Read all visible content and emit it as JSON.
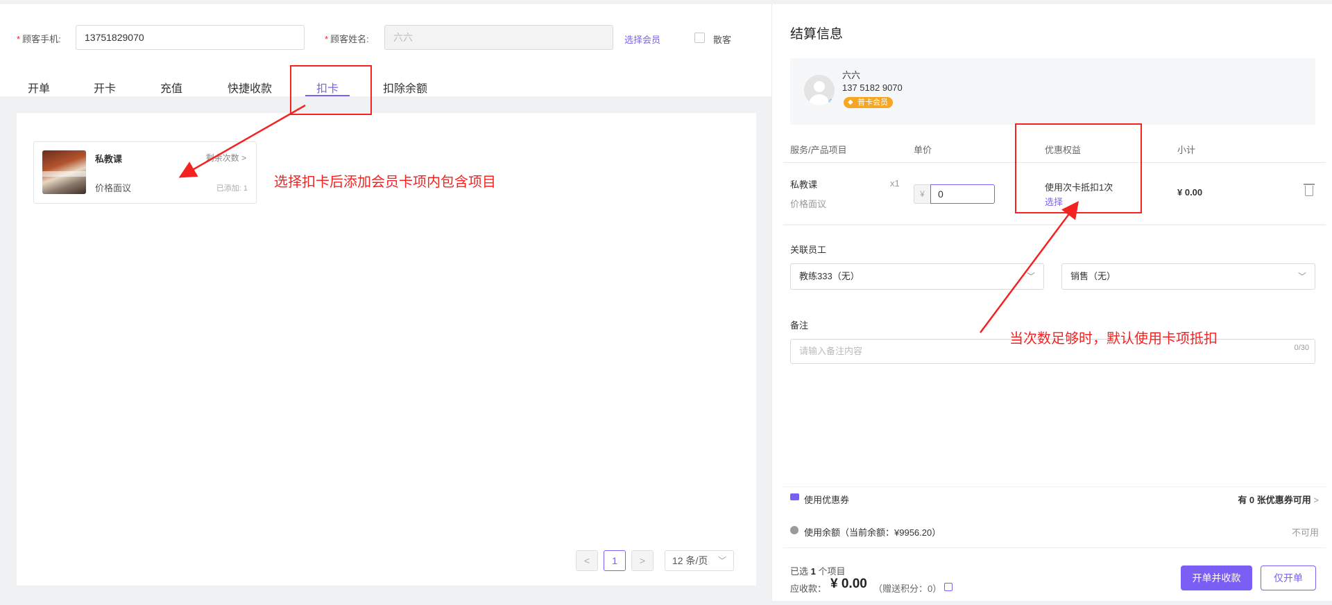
{
  "customer_form": {
    "phone_label": "顾客手机:",
    "phone_value": "13751829070",
    "name_label": "顾客姓名:",
    "name_value": "六六",
    "select_member_link": "选择会员",
    "walkin_label": "散客"
  },
  "tabs": [
    {
      "label": "开单",
      "active": false
    },
    {
      "label": "开卡",
      "active": false
    },
    {
      "label": "充值",
      "active": false
    },
    {
      "label": "快捷收款",
      "active": false
    },
    {
      "label": "扣卡",
      "active": true
    },
    {
      "label": "扣除余额",
      "active": false
    }
  ],
  "service_card": {
    "name": "私教课",
    "remain_label": "剩余次数",
    "chevron": ">",
    "price": "价格面议",
    "added": "已添加: 1"
  },
  "pagination": {
    "prev": "<",
    "page": "1",
    "next": ">",
    "page_size": "12 条/页",
    "chevron": "﹀"
  },
  "settlement": {
    "title": "结算信息",
    "member": {
      "name": "六六",
      "phone": "137 5182 9070",
      "badge": "普卡会员",
      "badge_icon": "diamond-icon",
      "gender": "♂"
    },
    "table_headers": [
      "服务/产品项目",
      "单价",
      "优惠权益",
      "小计"
    ],
    "item": {
      "name": "私教课",
      "sub": "价格面议",
      "qty": "x1",
      "currency": "¥",
      "price_value": "0",
      "benefit": "使用次卡抵扣1次",
      "benefit_select": "选择",
      "subtotal": "¥ 0.00"
    },
    "staff_label": "关联员工",
    "coach_select": "教练333（无）",
    "sales_select": "销售（无）",
    "dropdown_chevron": "﹀",
    "remark_label": "备注",
    "remark_placeholder": "请输入备注内容",
    "remark_counter": "0/30",
    "coupon_label": "使用优惠券",
    "coupon_right": "有 0 张优惠券可用",
    "coupon_chevron": ">",
    "balance_label": "使用余额（当前余额：¥9956.20）",
    "balance_right": "不可用",
    "selected_prefix": "已选",
    "selected_count": "1",
    "selected_suffix": "个项目",
    "due_label": "应收款：",
    "due_amount": "¥ 0.00",
    "points": "（赠送积分：0）",
    "btn_checkout": "开单并收款",
    "btn_open_only": "仅开单"
  },
  "annotations": {
    "left_note": "选择扣卡后添加会员卡项内包含项目",
    "right_note": "当次数足够时，默认使用卡项抵扣"
  },
  "colors": {
    "accent": "#7b5ff5",
    "annotation": "#f52222",
    "badge": "#f5a623",
    "panel_bg": "#f0f1f3"
  }
}
